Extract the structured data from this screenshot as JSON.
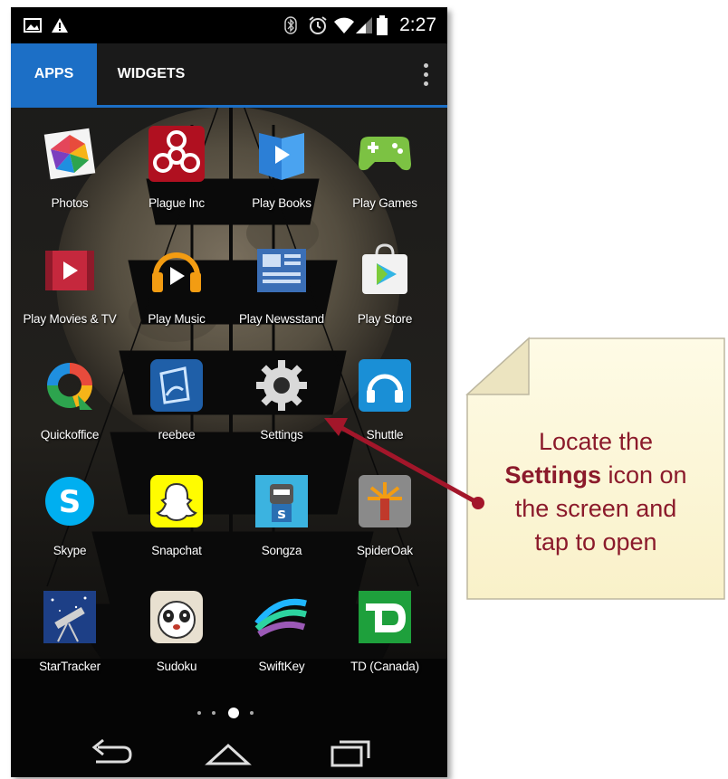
{
  "status_bar": {
    "time": "2:27",
    "icons": [
      "image-icon",
      "warning-icon",
      "bluetooth-icon",
      "alarm-icon",
      "wifi-icon",
      "signal-icon",
      "battery-icon"
    ]
  },
  "tabs": [
    {
      "label": "APPS",
      "selected": true
    },
    {
      "label": "WIDGETS",
      "selected": false
    }
  ],
  "apps": [
    {
      "label": "Photos",
      "icon": "photos-icon"
    },
    {
      "label": "Plague Inc",
      "icon": "plague-inc-icon"
    },
    {
      "label": "Play Books",
      "icon": "play-books-icon"
    },
    {
      "label": "Play Games",
      "icon": "play-games-icon"
    },
    {
      "label": "Play Movies & TV",
      "icon": "play-movies-icon"
    },
    {
      "label": "Play Music",
      "icon": "play-music-icon"
    },
    {
      "label": "Play Newsstand",
      "icon": "play-newsstand-icon"
    },
    {
      "label": "Play Store",
      "icon": "play-store-icon"
    },
    {
      "label": "Quickoffice",
      "icon": "quickoffice-icon"
    },
    {
      "label": "reebee",
      "icon": "reebee-icon"
    },
    {
      "label": "Settings",
      "icon": "settings-icon"
    },
    {
      "label": "Shuttle",
      "icon": "shuttle-icon"
    },
    {
      "label": "Skype",
      "icon": "skype-icon"
    },
    {
      "label": "Snapchat",
      "icon": "snapchat-icon"
    },
    {
      "label": "Songza",
      "icon": "songza-icon"
    },
    {
      "label": "SpiderOak",
      "icon": "spideroak-icon"
    },
    {
      "label": "StarTracker",
      "icon": "startracker-icon"
    },
    {
      "label": "Sudoku",
      "icon": "sudoku-icon"
    },
    {
      "label": "SwiftKey",
      "icon": "swiftkey-icon"
    },
    {
      "label": "TD (Canada)",
      "icon": "td-canada-icon"
    }
  ],
  "pager": {
    "pages": 4,
    "current_page": 3
  },
  "nav": [
    "back-icon",
    "home-icon",
    "recents-icon"
  ],
  "callout": {
    "line1": "Locate the",
    "bold": "Settings",
    "line2_rest": " icon on",
    "line3": "the screen and",
    "line4": "tap to open"
  },
  "colors": {
    "accent": "#1c6fc6",
    "note_fill": "#fdf8d8",
    "note_text": "#8b1a2b",
    "arrow": "#a3162a"
  }
}
